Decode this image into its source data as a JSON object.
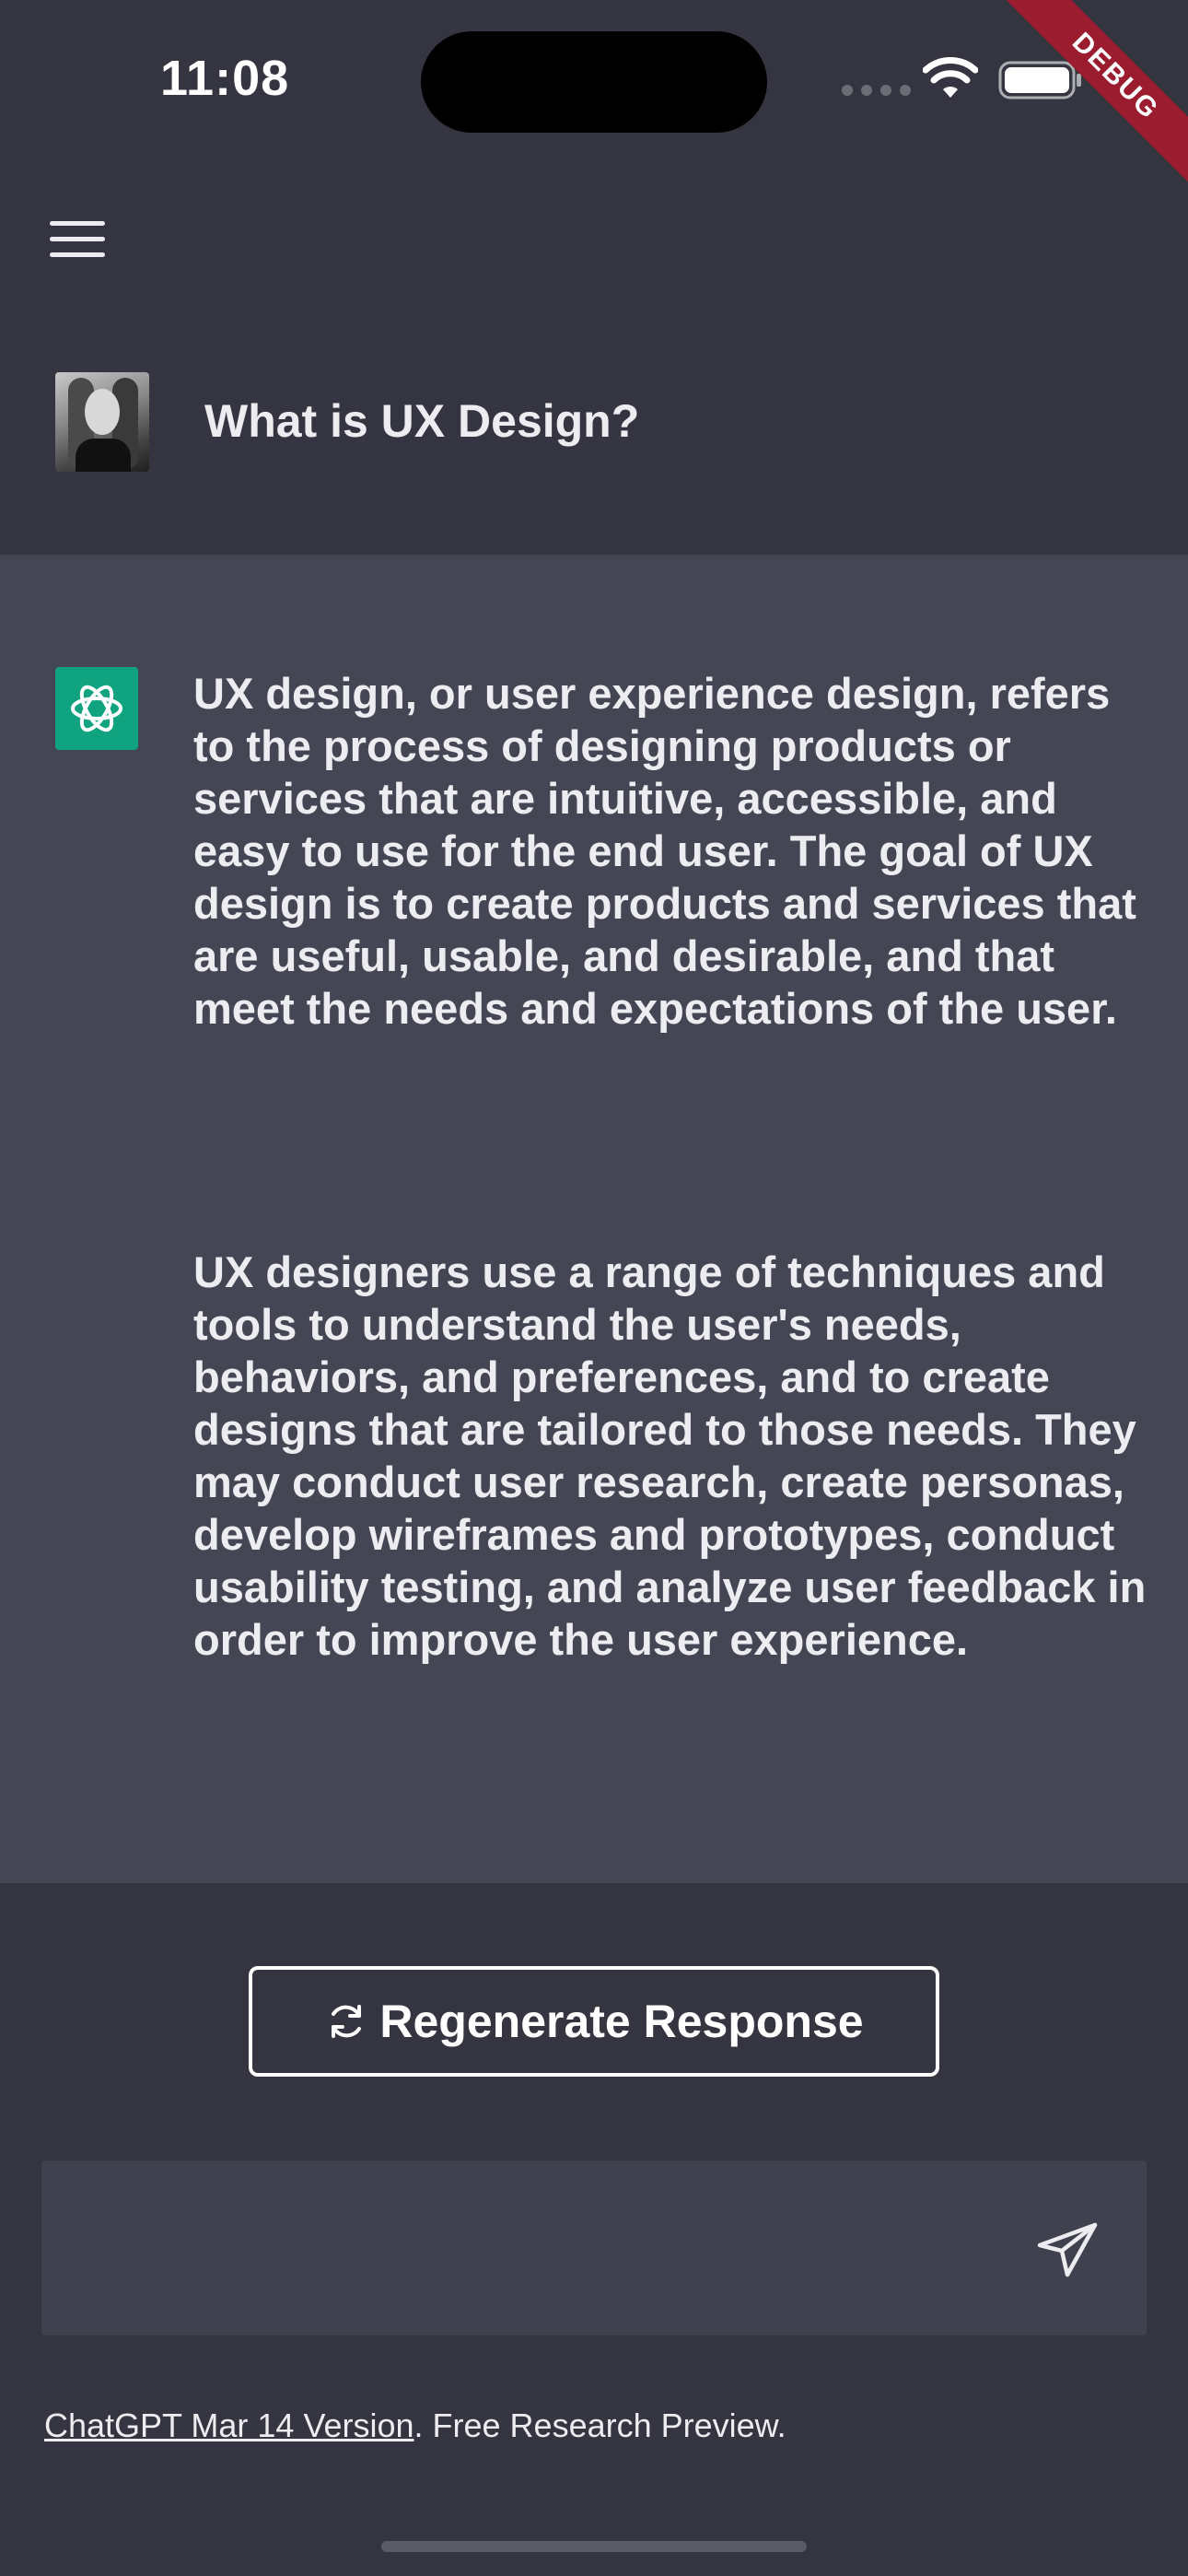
{
  "status_bar": {
    "time": "11:08",
    "icons": [
      "signal-dots-icon",
      "wifi-icon",
      "battery-icon"
    ]
  },
  "debug_banner": "DEBUG",
  "header": {
    "menu_icon": "hamburger-menu-icon"
  },
  "conversation": {
    "user_message": "What is UX Design?",
    "assistant_paragraphs": [
      "UX design, or user experience design, refers to the process of designing products or services that are intuitive, accessible, and easy to use for the end user. The goal of UX design is to create products and services that are useful, usable, and desirable, and that meet the needs and expectations of the user.",
      "UX designers use a range of techniques and tools to understand the user's needs, behaviors, and preferences, and to create designs that are tailored to those needs. They may conduct user research, create personas, develop wireframes and prototypes, conduct usability testing, and analyze user feedback in order to improve the user experience."
    ]
  },
  "actions": {
    "regenerate_label": "Regenerate Response",
    "regenerate_icon": "refresh-icon"
  },
  "composer": {
    "input_value": "",
    "send_icon": "send-icon"
  },
  "footer": {
    "link_text": "ChatGPT Mar 14 Version",
    "suffix_text": ". Free Research Preview."
  },
  "colors": {
    "background": "#343541",
    "response_background": "#444654",
    "input_background": "#40414F",
    "brand_green": "#10A37F",
    "debug_red": "#9B1C2E"
  }
}
